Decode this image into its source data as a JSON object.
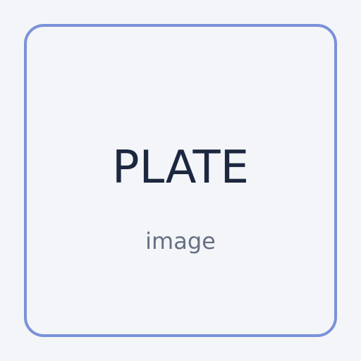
{
  "plate": {
    "title": "PLATE",
    "subtitle": "image"
  },
  "colors": {
    "background": "#f4f5f8",
    "accent": "#7b91d9",
    "title": "#1c2740",
    "subtitle": "#667085"
  }
}
